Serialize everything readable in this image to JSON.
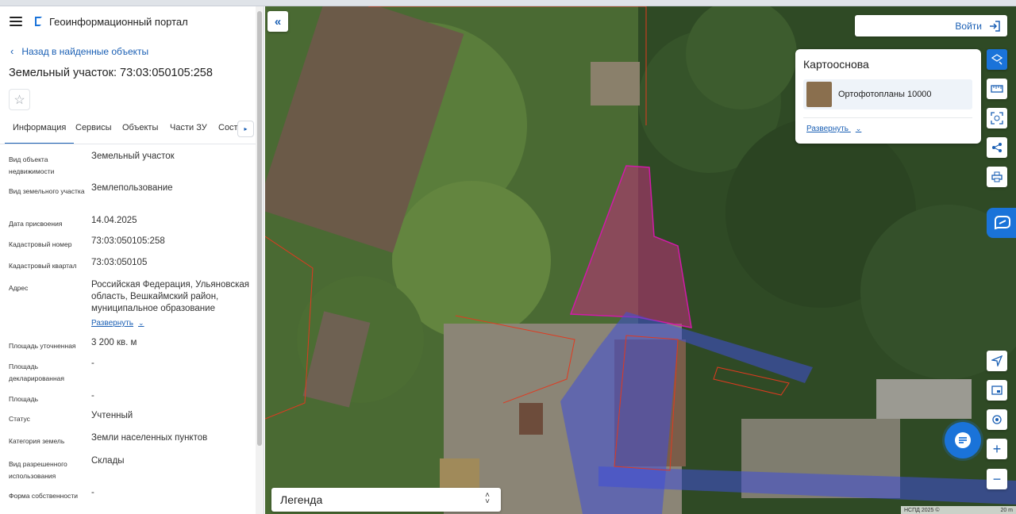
{
  "header": {
    "brand": "Геоинформационный портал"
  },
  "nav": {
    "back_label": "Назад в найденные объекты"
  },
  "object": {
    "title": "Земельный участок: 73:03:050105:258"
  },
  "tabs": [
    {
      "label": "Информация"
    },
    {
      "label": "Сервисы"
    },
    {
      "label": "Объекты"
    },
    {
      "label": "Части ЗУ"
    },
    {
      "label": "Соста"
    }
  ],
  "properties": [
    {
      "label": "Вид объекта недвижимости",
      "value": "Земельный участок"
    },
    {
      "label": "Вид земельного участка",
      "value": "Землепользование"
    },
    {
      "label": "Дата присвоения",
      "value": "14.04.2025"
    },
    {
      "label": "Кадастровый номер",
      "value": "73:03:050105:258"
    },
    {
      "label": "Кадастровый квартал",
      "value": "73:03:050105"
    },
    {
      "label": "Адрес",
      "value": "Российская Федерация, Ульяновская область, Вешкаймский район, муниципальное образование",
      "expand_label": "Развернуть"
    },
    {
      "label": "Площадь уточненная",
      "value": "3 200 кв. м"
    },
    {
      "label": "Площадь декларированная",
      "value": "-"
    },
    {
      "label": "Площадь",
      "value": "-"
    },
    {
      "label": "Статус",
      "value": "Учтенный"
    },
    {
      "label": "Категория земель",
      "value": "Земли населенных пунктов"
    },
    {
      "label": "Вид разрешенного использования",
      "value": "Склады"
    },
    {
      "label": "Форма собственности",
      "value": "-"
    }
  ],
  "map": {
    "login_label": "Войти",
    "basemap": {
      "title": "Картооснова",
      "layer": "Ортофотопланы 10000",
      "expand_label": "Развернуть"
    },
    "legend_label": "Легенда",
    "attribution": "НСПД 2025 ©",
    "scale": "20 m",
    "colors": {
      "parcel_fill": "#c0307a",
      "boundary": "#e03a20",
      "zone_fill": "#3f4fd8",
      "accent": "#1a73d9"
    }
  }
}
